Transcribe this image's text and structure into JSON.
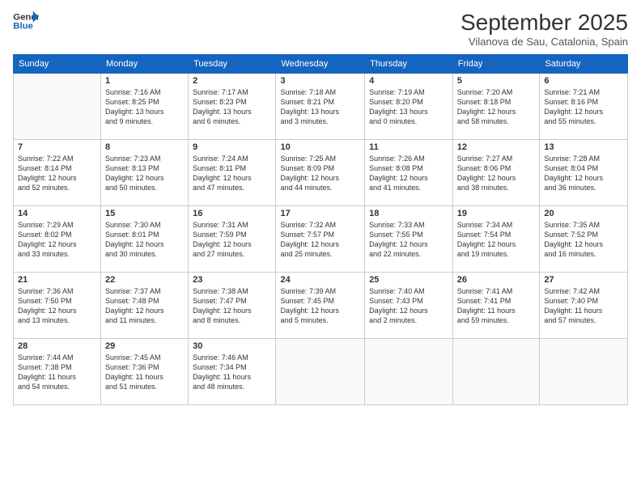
{
  "logo": {
    "line1": "General",
    "line2": "Blue"
  },
  "title": "September 2025",
  "subtitle": "Vilanova de Sau, Catalonia, Spain",
  "days_of_week": [
    "Sunday",
    "Monday",
    "Tuesday",
    "Wednesday",
    "Thursday",
    "Friday",
    "Saturday"
  ],
  "weeks": [
    [
      {
        "day": "",
        "info": ""
      },
      {
        "day": "1",
        "info": "Sunrise: 7:16 AM\nSunset: 8:25 PM\nDaylight: 13 hours\nand 9 minutes."
      },
      {
        "day": "2",
        "info": "Sunrise: 7:17 AM\nSunset: 8:23 PM\nDaylight: 13 hours\nand 6 minutes."
      },
      {
        "day": "3",
        "info": "Sunrise: 7:18 AM\nSunset: 8:21 PM\nDaylight: 13 hours\nand 3 minutes."
      },
      {
        "day": "4",
        "info": "Sunrise: 7:19 AM\nSunset: 8:20 PM\nDaylight: 13 hours\nand 0 minutes."
      },
      {
        "day": "5",
        "info": "Sunrise: 7:20 AM\nSunset: 8:18 PM\nDaylight: 12 hours\nand 58 minutes."
      },
      {
        "day": "6",
        "info": "Sunrise: 7:21 AM\nSunset: 8:16 PM\nDaylight: 12 hours\nand 55 minutes."
      }
    ],
    [
      {
        "day": "7",
        "info": "Sunrise: 7:22 AM\nSunset: 8:14 PM\nDaylight: 12 hours\nand 52 minutes."
      },
      {
        "day": "8",
        "info": "Sunrise: 7:23 AM\nSunset: 8:13 PM\nDaylight: 12 hours\nand 50 minutes."
      },
      {
        "day": "9",
        "info": "Sunrise: 7:24 AM\nSunset: 8:11 PM\nDaylight: 12 hours\nand 47 minutes."
      },
      {
        "day": "10",
        "info": "Sunrise: 7:25 AM\nSunset: 8:09 PM\nDaylight: 12 hours\nand 44 minutes."
      },
      {
        "day": "11",
        "info": "Sunrise: 7:26 AM\nSunset: 8:08 PM\nDaylight: 12 hours\nand 41 minutes."
      },
      {
        "day": "12",
        "info": "Sunrise: 7:27 AM\nSunset: 8:06 PM\nDaylight: 12 hours\nand 38 minutes."
      },
      {
        "day": "13",
        "info": "Sunrise: 7:28 AM\nSunset: 8:04 PM\nDaylight: 12 hours\nand 36 minutes."
      }
    ],
    [
      {
        "day": "14",
        "info": "Sunrise: 7:29 AM\nSunset: 8:02 PM\nDaylight: 12 hours\nand 33 minutes."
      },
      {
        "day": "15",
        "info": "Sunrise: 7:30 AM\nSunset: 8:01 PM\nDaylight: 12 hours\nand 30 minutes."
      },
      {
        "day": "16",
        "info": "Sunrise: 7:31 AM\nSunset: 7:59 PM\nDaylight: 12 hours\nand 27 minutes."
      },
      {
        "day": "17",
        "info": "Sunrise: 7:32 AM\nSunset: 7:57 PM\nDaylight: 12 hours\nand 25 minutes."
      },
      {
        "day": "18",
        "info": "Sunrise: 7:33 AM\nSunset: 7:55 PM\nDaylight: 12 hours\nand 22 minutes."
      },
      {
        "day": "19",
        "info": "Sunrise: 7:34 AM\nSunset: 7:54 PM\nDaylight: 12 hours\nand 19 minutes."
      },
      {
        "day": "20",
        "info": "Sunrise: 7:35 AM\nSunset: 7:52 PM\nDaylight: 12 hours\nand 16 minutes."
      }
    ],
    [
      {
        "day": "21",
        "info": "Sunrise: 7:36 AM\nSunset: 7:50 PM\nDaylight: 12 hours\nand 13 minutes."
      },
      {
        "day": "22",
        "info": "Sunrise: 7:37 AM\nSunset: 7:48 PM\nDaylight: 12 hours\nand 11 minutes."
      },
      {
        "day": "23",
        "info": "Sunrise: 7:38 AM\nSunset: 7:47 PM\nDaylight: 12 hours\nand 8 minutes."
      },
      {
        "day": "24",
        "info": "Sunrise: 7:39 AM\nSunset: 7:45 PM\nDaylight: 12 hours\nand 5 minutes."
      },
      {
        "day": "25",
        "info": "Sunrise: 7:40 AM\nSunset: 7:43 PM\nDaylight: 12 hours\nand 2 minutes."
      },
      {
        "day": "26",
        "info": "Sunrise: 7:41 AM\nSunset: 7:41 PM\nDaylight: 11 hours\nand 59 minutes."
      },
      {
        "day": "27",
        "info": "Sunrise: 7:42 AM\nSunset: 7:40 PM\nDaylight: 11 hours\nand 57 minutes."
      }
    ],
    [
      {
        "day": "28",
        "info": "Sunrise: 7:44 AM\nSunset: 7:38 PM\nDaylight: 11 hours\nand 54 minutes."
      },
      {
        "day": "29",
        "info": "Sunrise: 7:45 AM\nSunset: 7:36 PM\nDaylight: 11 hours\nand 51 minutes."
      },
      {
        "day": "30",
        "info": "Sunrise: 7:46 AM\nSunset: 7:34 PM\nDaylight: 11 hours\nand 48 minutes."
      },
      {
        "day": "",
        "info": ""
      },
      {
        "day": "",
        "info": ""
      },
      {
        "day": "",
        "info": ""
      },
      {
        "day": "",
        "info": ""
      }
    ]
  ]
}
